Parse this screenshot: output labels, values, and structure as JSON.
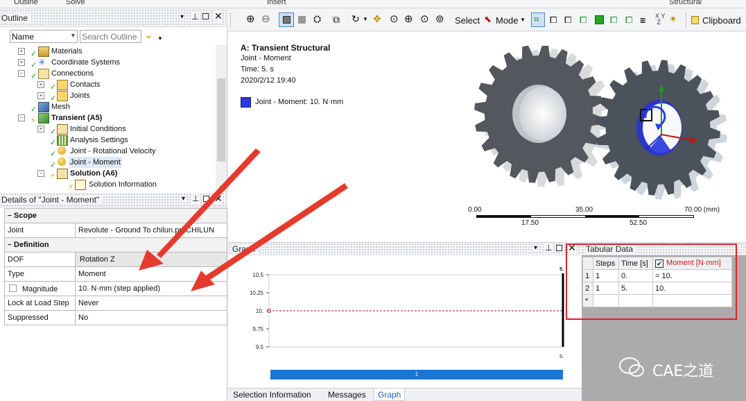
{
  "ribbon": {
    "outline": "Outline",
    "solve": "Solve",
    "insert": "Insert",
    "structural": "Structural"
  },
  "outline": {
    "title": "Outline",
    "name_filter": "Name",
    "search_placeholder": "Search Outline",
    "items": [
      {
        "label": "Materials"
      },
      {
        "label": "Coordinate Systems"
      },
      {
        "label": "Connections"
      },
      {
        "label": "Contacts"
      },
      {
        "label": "Joints"
      },
      {
        "label": "Mesh"
      },
      {
        "label": "Transient (A5)"
      },
      {
        "label": "Initial Conditions"
      },
      {
        "label": "Analysis Settings"
      },
      {
        "label": "Joint - Rotational Velocity"
      },
      {
        "label": "Joint - Moment"
      },
      {
        "label": "Solution (A6)"
      },
      {
        "label": "Solution Information"
      }
    ]
  },
  "details": {
    "title": "Details of \"Joint - Moment\"",
    "scope_header": "Scope",
    "joint_label": "Joint",
    "joint_value": "Revolute - Ground To chilun.prt\\CHILUN",
    "definition_header": "Definition",
    "dof_label": "DOF",
    "dof_value": "Rotation Z",
    "type_label": "Type",
    "type_value": "Moment",
    "magnitude_label": "Magnitude",
    "magnitude_value": "10. N·mm  (step applied)",
    "lock_label": "Lock at Load Step",
    "lock_value": "Never",
    "suppressed_label": "Suppressed",
    "suppressed_value": "No"
  },
  "toolbar": {
    "select_label": "Select",
    "mode_label": "Mode",
    "clipboard_label": "Clipboard"
  },
  "viewport": {
    "title": "A: Transient Structural",
    "subtitle": "Joint - Moment",
    "time": "Time: 5. s",
    "date": "2020/2/12 19:40",
    "legend_label": "Joint - Moment: 10. N·mm",
    "legend_color": "#2a3ae8",
    "scale": {
      "top": [
        "0.00",
        "35.00",
        "70.00 (mm)"
      ],
      "bottom": [
        "17.50",
        "52.50"
      ]
    }
  },
  "graph": {
    "title": "Graph",
    "bar_label": "1",
    "chart_data": {
      "type": "line",
      "x_end_label": "5.",
      "yticks": [
        "10.5",
        "10.25",
        "10.",
        "9.75",
        "9.5"
      ],
      "ylim": [
        9.5,
        10.5
      ],
      "series": [
        {
          "x": [
            0,
            5
          ],
          "values": [
            10,
            10
          ]
        }
      ]
    }
  },
  "tabular": {
    "title": "Tabular Data",
    "headers": [
      "Steps",
      "Time [s]",
      "Moment [N·mm]"
    ],
    "rows": [
      {
        "idx": "1",
        "steps": "1",
        "time": "0.",
        "moment": "= 10."
      },
      {
        "idx": "2",
        "steps": "1",
        "time": "5.",
        "moment": "10."
      }
    ],
    "new_row": "*"
  },
  "bottom_tabs": [
    "Selection Information",
    "Messages",
    "Graph"
  ],
  "watermark": "CAE之道"
}
